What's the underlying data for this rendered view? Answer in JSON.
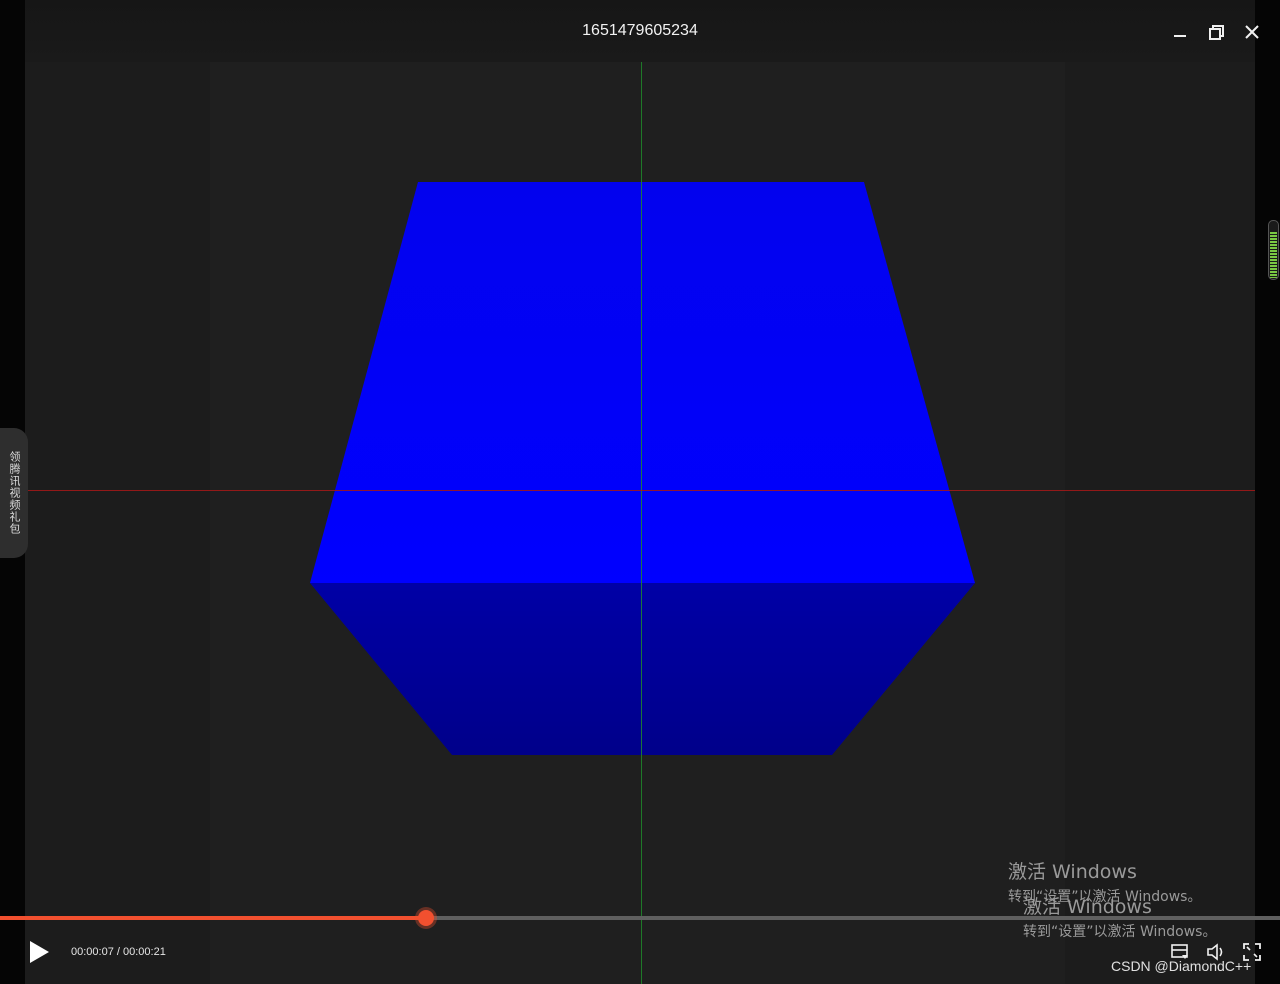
{
  "window": {
    "title": "1651479605234"
  },
  "side_tab": {
    "label": "领腾讯视频礼包"
  },
  "player": {
    "current_time": "00:00:07",
    "separator": "/",
    "total_time": "00:00:21",
    "progress_fraction": 0.333,
    "volume_level": 0.8
  },
  "activation_notices": [
    {
      "title": "激活 Windows",
      "subtitle": "转到“设置”以激活 Windows。"
    },
    {
      "title": "激活 Windows",
      "subtitle": "转到“设置”以激活 Windows。"
    }
  ],
  "watermark": "CSDN @DiamondC++",
  "icons": {
    "minimize": "minimize-icon",
    "restore": "restore-icon",
    "close": "close-icon",
    "play": "play-icon",
    "playlist": "playlist-icon",
    "volume": "volume-icon",
    "fullscreen": "fullscreen-icon"
  },
  "colors": {
    "cube_top": "#0000f6",
    "cube_front": "#00009a",
    "progress": "#f2502f",
    "crosshair_vertical": "#1f8a2a",
    "crosshair_horizontal": "#a01818"
  }
}
